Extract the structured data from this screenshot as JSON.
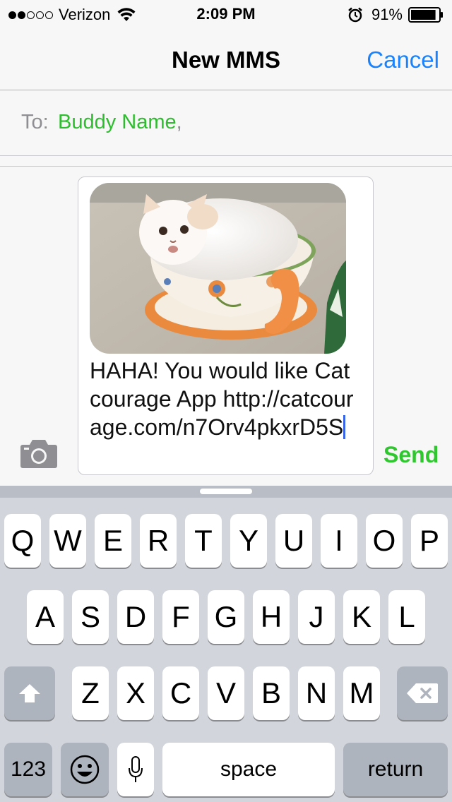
{
  "status_bar": {
    "carrier": "Verizon",
    "signal_dots": [
      true,
      true,
      false,
      false,
      false
    ],
    "time": "2:09 PM",
    "battery": "91%",
    "battery_level": 0.91
  },
  "nav": {
    "title": "New MMS",
    "cancel_label": "Cancel"
  },
  "to_field": {
    "label": "To:",
    "recipient": "Buddy Name",
    "separator": ","
  },
  "compose": {
    "message_text": "HAHA! You would like Catcourage App http://catcourage.com/n7Orv4pkxrD5S",
    "send_label": "Send",
    "attachment_icon": "cat-in-teacup-photo"
  },
  "keyboard": {
    "row1": [
      "Q",
      "W",
      "E",
      "R",
      "T",
      "Y",
      "U",
      "I",
      "O",
      "P"
    ],
    "row2": [
      "A",
      "S",
      "D",
      "F",
      "G",
      "H",
      "J",
      "K",
      "L"
    ],
    "row3": [
      "Z",
      "X",
      "C",
      "V",
      "B",
      "N",
      "M"
    ],
    "numbers_label": "123",
    "space_label": "space",
    "return_label": "return"
  },
  "colors": {
    "accent_blue": "#1a82fb",
    "recipient_green": "#2ebd2e",
    "send_green": "#2ec72e",
    "caret_blue": "#3764e8"
  }
}
